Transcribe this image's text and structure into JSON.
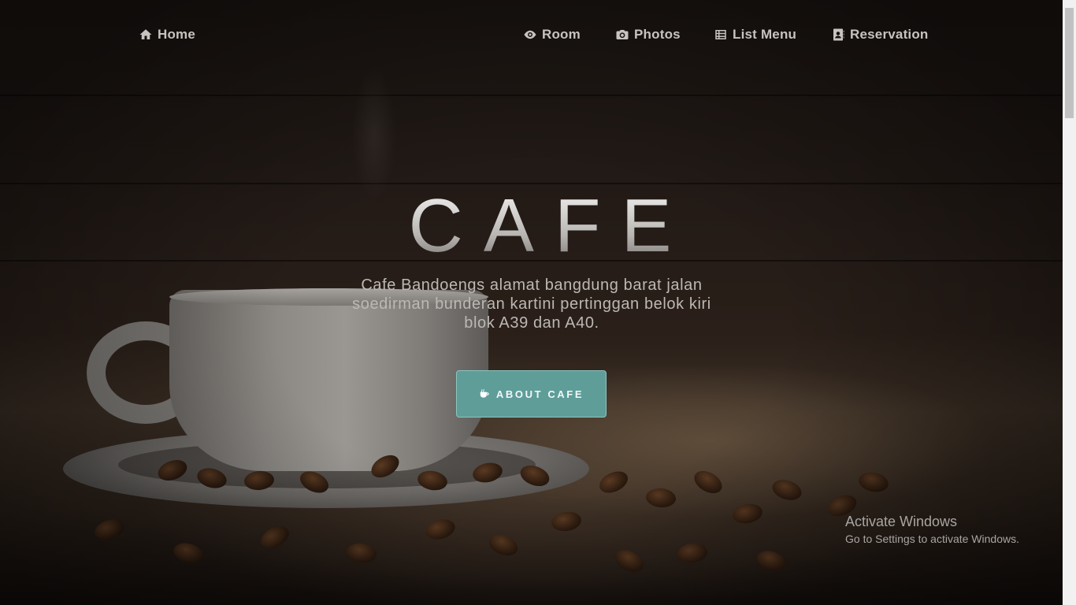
{
  "nav": {
    "home": {
      "label": "Home",
      "icon": "home-icon"
    },
    "room": {
      "label": "Room",
      "icon": "eye-icon"
    },
    "photos": {
      "label": "Photos",
      "icon": "camera-icon"
    },
    "list_menu": {
      "label": "List Menu",
      "icon": "list-icon"
    },
    "reservation": {
      "label": "Reservation",
      "icon": "address-book-icon"
    }
  },
  "hero": {
    "title": "CAFE",
    "description": "Cafe Bandoengs alamat bangdung barat jalan soedirman bunderan kartini pertinggan belok kiri blok A39 dan A40.",
    "button_label": "ABOUT CAFE",
    "button_icon": "coffee-cup-icon"
  },
  "windows_watermark": {
    "title": "Activate Windows",
    "subtitle": "Go to Settings to activate Windows."
  },
  "colors": {
    "accent_button": "#5f9d99",
    "nav_text": "#c7c3bf",
    "background": "#1a1411"
  }
}
